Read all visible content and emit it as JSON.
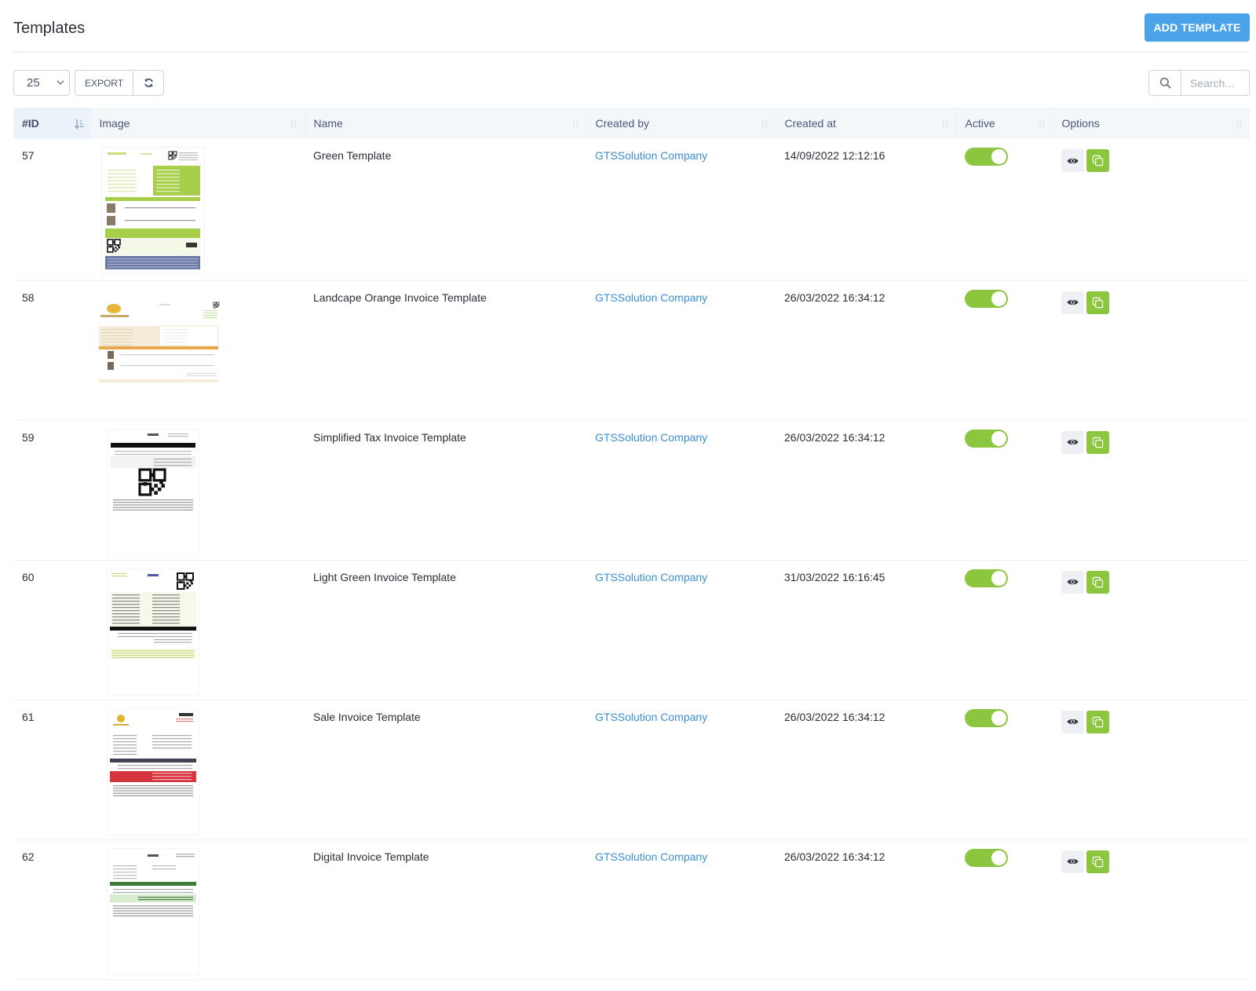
{
  "header": {
    "title": "Templates",
    "add_button": "ADD TEMPLATE"
  },
  "toolbar": {
    "page_size": "25",
    "export_label": "EXPORT",
    "refresh_icon": "refresh-icon",
    "search_placeholder": "Search...",
    "search_value": ""
  },
  "table": {
    "columns": [
      {
        "label": "#ID",
        "sorted": "desc"
      },
      {
        "label": "Image"
      },
      {
        "label": "Name"
      },
      {
        "label": "Created by"
      },
      {
        "label": "Created at"
      },
      {
        "label": "Active"
      },
      {
        "label": "Options"
      }
    ],
    "rows": [
      {
        "id": "57",
        "thumbnail": "green-template-preview",
        "name": "Green Template",
        "created_by": "GTSSolution Company",
        "created_at": "14/09/2022 12:12:16",
        "active": true
      },
      {
        "id": "58",
        "thumbnail": "landscape-orange-invoice-preview",
        "name": "Landcape Orange Invoice Template",
        "created_by": "GTSSolution Company",
        "created_at": "26/03/2022 16:34:12",
        "active": true
      },
      {
        "id": "59",
        "thumbnail": "simplified-tax-invoice-preview",
        "name": "Simplified Tax Invoice Template",
        "created_by": "GTSSolution Company",
        "created_at": "26/03/2022 16:34:12",
        "active": true
      },
      {
        "id": "60",
        "thumbnail": "light-green-invoice-preview",
        "name": "Light Green Invoice Template",
        "created_by": "GTSSolution Company",
        "created_at": "31/03/2022 16:16:45",
        "active": true
      },
      {
        "id": "61",
        "thumbnail": "sale-invoice-preview",
        "name": "Sale Invoice Template",
        "created_by": "GTSSolution Company",
        "created_at": "26/03/2022 16:34:12",
        "active": true
      },
      {
        "id": "62",
        "thumbnail": "digital-invoice-preview",
        "name": "Digital Invoice Template",
        "created_by": "GTSSolution Company",
        "created_at": "26/03/2022 16:34:12",
        "active": true
      }
    ]
  },
  "colors": {
    "primary": "#4aa3e8",
    "toggle_on": "#8cc63e",
    "link": "#3b8ed0",
    "header_bg": "#f4f7fa"
  }
}
